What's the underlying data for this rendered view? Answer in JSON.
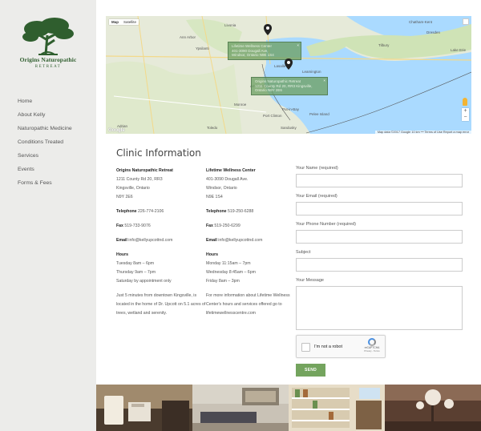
{
  "logo": {
    "name": "Origins Naturopathic",
    "subtitle": "RETREAT"
  },
  "nav": {
    "items": [
      {
        "label": "Home"
      },
      {
        "label": "About Kelly"
      },
      {
        "label": "Naturopathic Medicine"
      },
      {
        "label": "Conditions Treated"
      },
      {
        "label": "Services"
      },
      {
        "label": "Events"
      },
      {
        "label": "Forms & Fees"
      }
    ]
  },
  "map": {
    "tabs": [
      "Map",
      "Satellite"
    ],
    "labels": [
      "Chatham-Kent",
      "Livonia",
      "Ann Arbor",
      "Ypsilanti",
      "Lasalle",
      "Dresden",
      "Tilbury",
      "Amherstburg",
      "Leamington",
      "Monroe",
      "Toledo",
      "Adrian",
      "Pelee Island",
      "Lake Erie",
      "Port Clinton",
      "Sandusky",
      "Put-in-Bay"
    ],
    "infobox1": [
      "Lifetime Wellness Center",
      "401-3090 Dougall Ave,",
      "Windsor, Ontario N9E 1S4"
    ],
    "infobox2": [
      "Origins Naturopathic Retreat",
      "1211 County Rd 20, RR3 Kingsville,",
      "Ontario N9Y 2E6"
    ],
    "zoom_in": "+",
    "zoom_out": "−",
    "footer": "Map data ©2017 Google   10 km ⎯⎯   Terms of Use   Report a map error",
    "google": "Google"
  },
  "clinic": {
    "title": "Clinic Information",
    "col1": {
      "name": "Origins Naturopathic Retreat",
      "address1": "1211 County Rd 20, RR3",
      "address2": "Kingsville, Ontario",
      "address3": "N9Y 2E6",
      "tel_label": "Telephone",
      "tel": "226-774-2106",
      "fax_label": "Fax",
      "fax": "519-733-9076",
      "email_label": "Email",
      "email": "info@kellyupcottnd.com",
      "hours_label": "Hours",
      "hours1": "Tuesday 8am – 6pm",
      "hours2": "Thursday 9am – 7pm",
      "hours3": "Saturday by appointment only",
      "note": "Just 5 minutes from downtown Kingsville, is located in the home of Dr. Upcott on 5.1 acres of trees, wetland and serenity."
    },
    "col2": {
      "name": "Lifetime Wellness Center",
      "address1": "401-3090 Dougall Ave.",
      "address2": "Windsor, Ontario",
      "address3": "N9E 1S4",
      "tel_label": "Telephone",
      "tel": "519-250-6288",
      "fax_label": "Fax",
      "fax": "519-250-6299",
      "email_label": "Email",
      "email": "info@kellyupcottnd.com",
      "hours_label": "Hours",
      "hours1": "Monday 11:15am – 7pm",
      "hours2": "Wednesday 8:45am – 6pm",
      "hours3": "Friday 8am – 3pm",
      "note": "For more information about Lifetime Wellness Center's hours and services offered go to lifetimewellnesscentre.com"
    }
  },
  "form": {
    "name_label": "Your Name (required)",
    "email_label": "Your Email (required)",
    "phone_label": "Your Phone Number (required)",
    "subject_label": "Subject",
    "message_label": "Your Message",
    "captcha_text": "I'm not a robot",
    "captcha_brand": "reCAPTCHA",
    "captcha_terms": "Privacy - Terms",
    "send_label": "SEND"
  },
  "colors": {
    "accent": "#74a45e",
    "logo_green": "#2f5e2e",
    "sidebar_bg": "#ececea"
  }
}
